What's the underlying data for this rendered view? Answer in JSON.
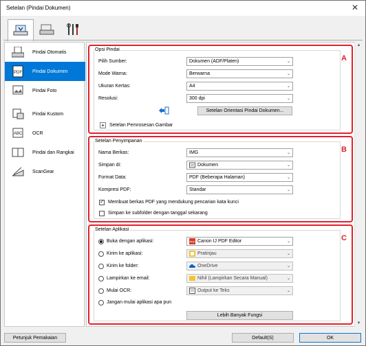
{
  "window": {
    "title": "Setelan (Pindai Dokumen)",
    "close_glyph": "✕"
  },
  "toptabs": [
    {
      "name": "scan-tab-icon"
    },
    {
      "name": "save-tab-icon"
    },
    {
      "name": "tools-tab-icon"
    }
  ],
  "sidebar": {
    "items": [
      {
        "label": "Pindai Otomatis",
        "icon": "auto-scan-icon"
      },
      {
        "label": "Pindai Dokumen",
        "icon": "document-scan-icon",
        "active": true
      },
      {
        "label": "Pindai Foto",
        "icon": "photo-scan-icon"
      },
      {
        "label": "Pindai Kustom",
        "icon": "custom-scan-icon"
      },
      {
        "label": "OCR",
        "icon": "ocr-icon"
      },
      {
        "label": "Pindai dan Rangkai",
        "icon": "scan-stitch-icon"
      },
      {
        "label": "ScanGear",
        "icon": "scangear-icon"
      }
    ]
  },
  "scan_options": {
    "title": "Opsi Pindai",
    "letter": "A",
    "source_label": "Pilih Sumber:",
    "source_value": "Dokumen (ADF/Platen)",
    "color_label": "Mode Warna:",
    "color_value": "Berwarna",
    "size_label": "Ukuran Kertas:",
    "size_value": "A4",
    "resolution_label": "Resolusi:",
    "resolution_value": "300 dpi",
    "orientation_button": "Setelan Orientasi Pindai Dokumen...",
    "image_processing_label": "Setelan Pemrosesan Gambar",
    "plus_glyph": "+"
  },
  "save_settings": {
    "title": "Setelan Penyimpanan",
    "letter": "B",
    "filename_label": "Nama Berkas:",
    "filename_value": "IMG",
    "savein_label": "Simpan di:",
    "savein_value": "Dokumen",
    "format_label": "Format Data:",
    "format_value": "PDF (Beberapa Halaman)",
    "compression_label": "Kompresi PDF:",
    "compression_value": "Standar",
    "searchable_pdf_label": "Membuat berkas PDF yang mendukung pencarian kata kunci",
    "searchable_pdf_checked": true,
    "subfolder_label": "Simpan ke subfolder dengan tanggal sekarang",
    "subfolder_checked": false,
    "check_glyph": "✓"
  },
  "app_settings": {
    "title": "Setelan Aplikasi",
    "letter": "C",
    "open_app_label": "Buka dengan aplikasi:",
    "open_app_value": "Canon IJ PDF Editor",
    "send_app_label": "Kirim ke aplikasi:",
    "send_app_value": "Pratinjau",
    "send_folder_label": "Kirim ke folder:",
    "send_folder_value": "OneDrive",
    "email_label": "Lampirkan ke email:",
    "email_value": "Nihil (Lampirkan Secara Manual)",
    "ocr_label": "Mulai OCR:",
    "ocr_value": "Output ke Teks",
    "none_label": "Jangan mulai aplikasi apa pun",
    "more_functions_button": "Lebih Banyak Fungsi",
    "selected": "open_app"
  },
  "footer": {
    "instructions_button": "Petunjuk Pemakaian",
    "defaults_button": "Default(S)",
    "ok_button": "OK"
  },
  "colors": {
    "accent": "#0078d7",
    "section_border": "#e0202c"
  },
  "scroll": {
    "up_glyph": "▲",
    "down_glyph": "▼"
  },
  "dropdown_glyph": "⌄"
}
